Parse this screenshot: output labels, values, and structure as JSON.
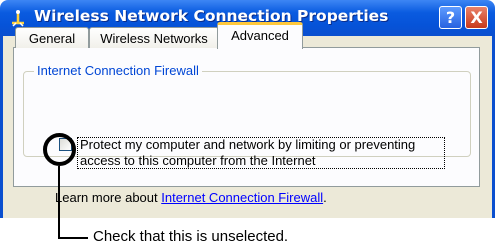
{
  "window": {
    "title": "Wireless Network Connection Properties",
    "help_button": "?",
    "close_button": "X"
  },
  "tabs": [
    {
      "label": "General",
      "selected": false
    },
    {
      "label": "Wireless Networks",
      "selected": false
    },
    {
      "label": "Advanced",
      "selected": true
    }
  ],
  "firewall_group": {
    "title": "Internet Connection Firewall",
    "checkbox_line1": "Protect my computer and network by limiting or preventing",
    "checkbox_line2": "access to this computer from the Internet",
    "checkbox_checked": false
  },
  "learn_more": {
    "prefix": "Learn more about ",
    "link": "Internet Connection Firewall",
    "suffix": "."
  },
  "annotation": {
    "callout": "Check that this is unselected."
  },
  "colors": {
    "titlebar": "#0a5be0",
    "dialog_bg": "#ece9d8",
    "active_tab_accent": "#ffc83c",
    "group_title": "#0046d5",
    "link": "#0000ff"
  }
}
